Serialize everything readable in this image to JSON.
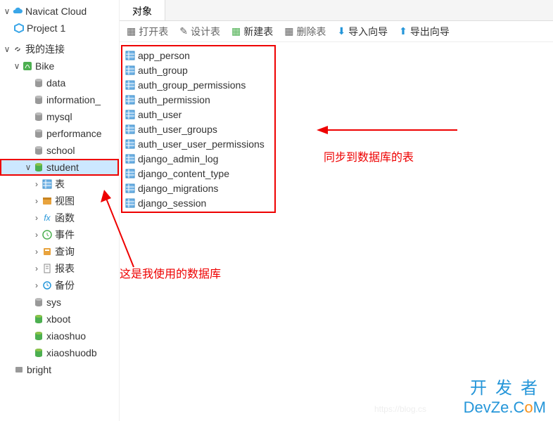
{
  "sidebar": {
    "navicat_cloud": "Navicat Cloud",
    "project1": "Project 1",
    "my_conn": "我的连接",
    "bike": {
      "label": "Bike",
      "children": [
        "data",
        "information_",
        "mysql",
        "performance",
        "school"
      ],
      "student": {
        "label": "student",
        "children": [
          "表",
          "视图",
          "函数",
          "事件",
          "查询",
          "报表",
          "备份"
        ]
      },
      "rest": [
        "sys",
        "xboot",
        "xiaoshuo",
        "xiaoshuodb"
      ]
    },
    "bright": "bright"
  },
  "tabs": {
    "objects": "对象"
  },
  "toolbar": {
    "open": "打开表",
    "design": "设计表",
    "new": "新建表",
    "delete": "删除表",
    "import": "导入向导",
    "export": "导出向导"
  },
  "tables": [
    "app_person",
    "auth_group",
    "auth_group_permissions",
    "auth_permission",
    "auth_user",
    "auth_user_groups",
    "auth_user_user_permissions",
    "django_admin_log",
    "django_content_type",
    "django_migrations",
    "django_session"
  ],
  "annotations": {
    "right": "同步到数据库的表",
    "left": "这是我使用的数据库"
  },
  "watermark": {
    "cn": "开发者",
    "en_pre": "DevZe.C",
    "en_o": "o",
    "en_post": "M",
    "faint": "https://blog.cs"
  }
}
